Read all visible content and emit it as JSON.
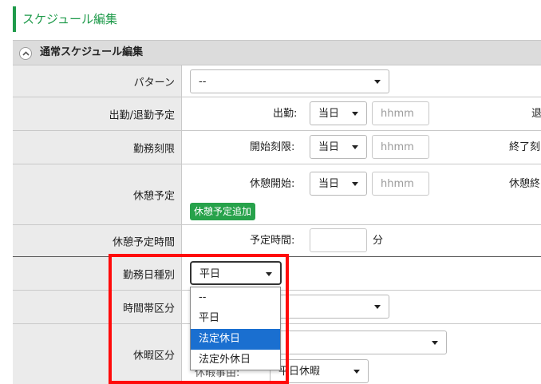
{
  "page": {
    "title": "スケジュール編集"
  },
  "section": {
    "title": "通常スケジュール編集",
    "toggle_icon": "chevron-up-icon"
  },
  "rows": {
    "pattern": {
      "label": "パターン",
      "select_value": "--"
    },
    "attendance": {
      "label": "出勤/退勤予定",
      "field1_label": "出勤:",
      "field1_day": "当日",
      "field1_placeholder": "hhmm",
      "field2_label": "退"
    },
    "work_limit": {
      "label": "勤務刻限",
      "field1_label": "開始刻限:",
      "field1_day": "当日",
      "field1_placeholder": "hhmm",
      "field2_label": "終了刻"
    },
    "break_plan": {
      "label": "休憩予定",
      "field1_label": "休憩開始:",
      "field1_day": "当日",
      "field1_placeholder": "hhmm",
      "field2_label": "休憩終",
      "add_button": "休憩予定追加"
    },
    "break_time": {
      "label": "休憩予定時間",
      "field_label": "予定時間:",
      "unit": "分"
    },
    "workday_type": {
      "label": "勤務日種別",
      "select_value": "平日"
    },
    "time_zone": {
      "label": "時間帯区分"
    },
    "leave_type": {
      "label": "休暇区分",
      "sub_select_value": "平日休暇",
      "sub_label_partial": "休暇事由:"
    }
  },
  "dropdown": {
    "options": [
      "--",
      "平日",
      "法定休日",
      "法定外休日"
    ],
    "selected_index": 2
  },
  "colors": {
    "accent_green": "#1e9a4a",
    "button_green": "#27a24b",
    "highlight_red": "#ff0a0a",
    "selection_blue": "#1a6fd0"
  }
}
